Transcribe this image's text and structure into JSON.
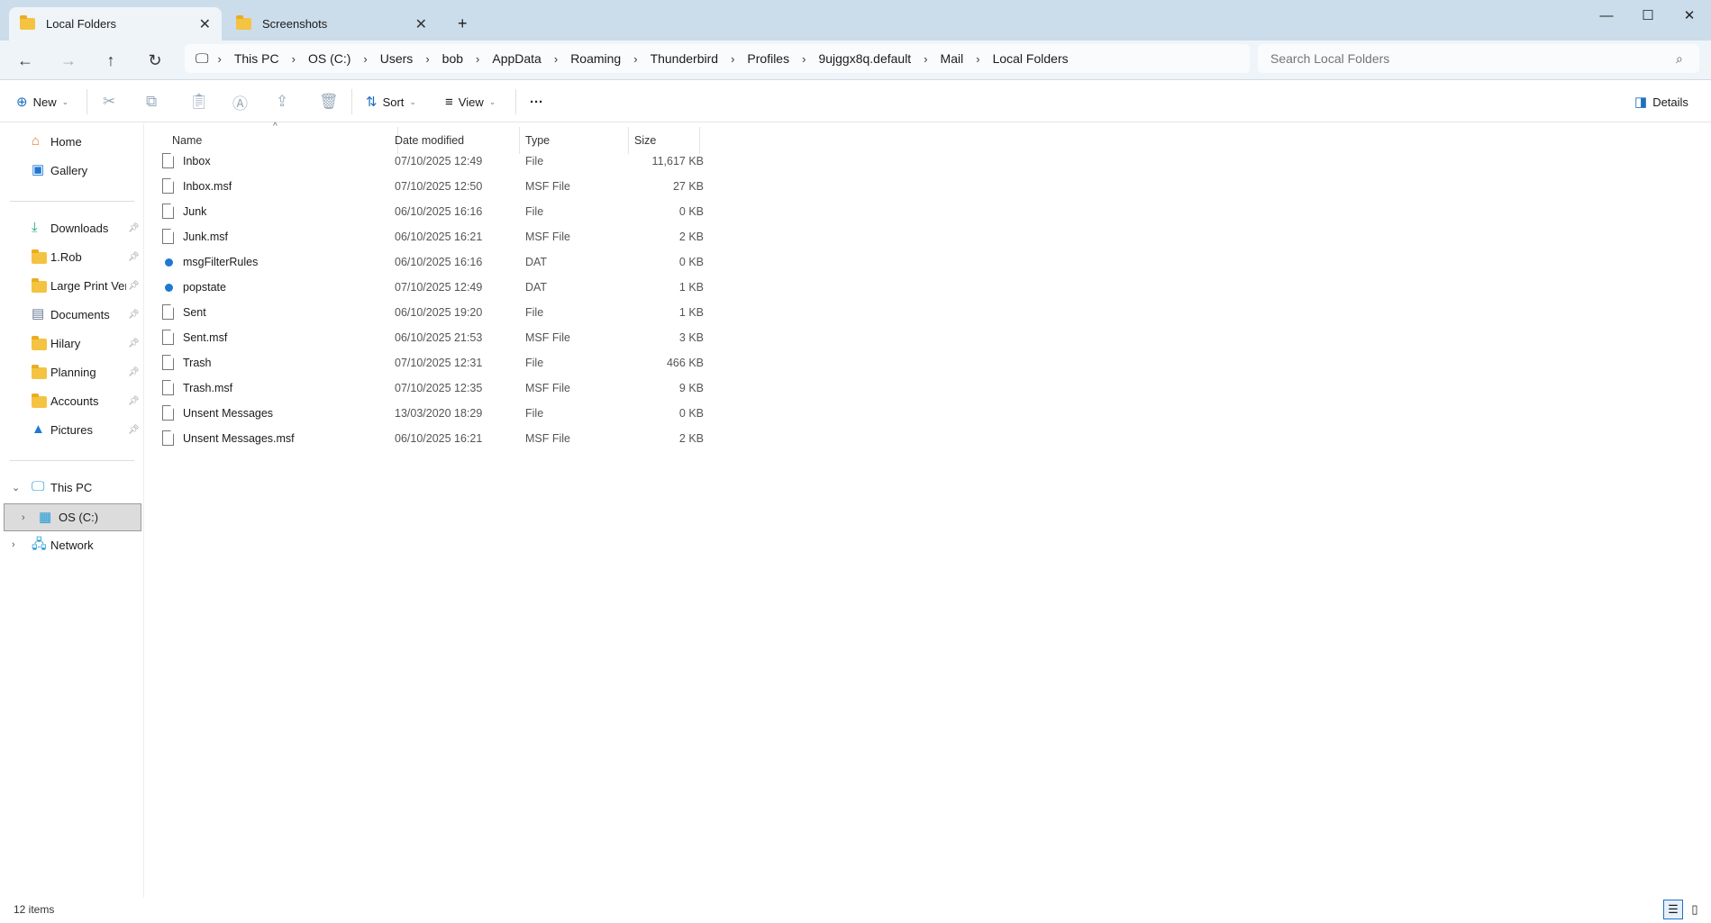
{
  "tabs": [
    {
      "label": "Local Folders",
      "active": true
    },
    {
      "label": "Screenshots",
      "active": false
    }
  ],
  "new_tab_label": "+",
  "breadcrumb": [
    "This PC",
    "OS (C:)",
    "Users",
    "bob",
    "AppData",
    "Roaming",
    "Thunderbird",
    "Profiles",
    "9ujggx8q.default",
    "Mail",
    "Local Folders"
  ],
  "search": {
    "placeholder": "Search Local Folders"
  },
  "toolbar": {
    "new": "New",
    "sort": "Sort",
    "view": "View",
    "more": "···",
    "details": "Details"
  },
  "sidebar": {
    "top": [
      {
        "label": "Home",
        "icon": "home-icon"
      },
      {
        "label": "Gallery",
        "icon": "gallery-icon"
      }
    ],
    "pinned": [
      {
        "label": "Downloads",
        "icon": "download-icon"
      },
      {
        "label": "1.Rob",
        "icon": "folder-icon"
      },
      {
        "label": "Large Print Versi",
        "icon": "folder-icon"
      },
      {
        "label": "Documents",
        "icon": "documents-icon"
      },
      {
        "label": "Hilary",
        "icon": "folder-icon"
      },
      {
        "label": "Planning",
        "icon": "folder-icon"
      },
      {
        "label": "Accounts",
        "icon": "folder-icon"
      },
      {
        "label": "Pictures",
        "icon": "pictures-icon"
      }
    ],
    "this_pc": "This PC",
    "os_c": "OS (C:)",
    "network": "Network"
  },
  "columns": {
    "name": "Name",
    "date": "Date modified",
    "type": "Type",
    "size": "Size"
  },
  "files": [
    {
      "name": "Inbox",
      "date": "07/10/2025 12:49",
      "type": "File",
      "size": "11,617 KB",
      "icon": "file"
    },
    {
      "name": "Inbox.msf",
      "date": "07/10/2025 12:50",
      "type": "MSF File",
      "size": "27 KB",
      "icon": "file"
    },
    {
      "name": "Junk",
      "date": "06/10/2025 16:16",
      "type": "File",
      "size": "0 KB",
      "icon": "file"
    },
    {
      "name": "Junk.msf",
      "date": "06/10/2025 16:21",
      "type": "MSF File",
      "size": "2 KB",
      "icon": "file"
    },
    {
      "name": "msgFilterRules",
      "date": "06/10/2025 16:16",
      "type": "DAT",
      "size": "0 KB",
      "icon": "dat"
    },
    {
      "name": "popstate",
      "date": "07/10/2025 12:49",
      "type": "DAT",
      "size": "1 KB",
      "icon": "dat"
    },
    {
      "name": "Sent",
      "date": "06/10/2025 19:20",
      "type": "File",
      "size": "1 KB",
      "icon": "file"
    },
    {
      "name": "Sent.msf",
      "date": "06/10/2025 21:53",
      "type": "MSF File",
      "size": "3 KB",
      "icon": "file"
    },
    {
      "name": "Trash",
      "date": "07/10/2025 12:31",
      "type": "File",
      "size": "466 KB",
      "icon": "file"
    },
    {
      "name": "Trash.msf",
      "date": "07/10/2025 12:35",
      "type": "MSF File",
      "size": "9 KB",
      "icon": "file"
    },
    {
      "name": "Unsent Messages",
      "date": "13/03/2020 18:29",
      "type": "File",
      "size": "0 KB",
      "icon": "file"
    },
    {
      "name": "Unsent Messages.msf",
      "date": "06/10/2025 16:21",
      "type": "MSF File",
      "size": "2 KB",
      "icon": "file"
    }
  ],
  "status": {
    "count": "12 items"
  }
}
